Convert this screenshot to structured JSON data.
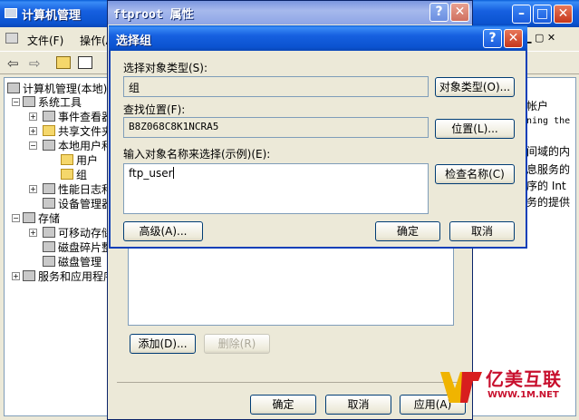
{
  "main_window": {
    "title": "计算机管理",
    "menu": [
      "文件(F)",
      "操作(A)"
    ],
    "tree": {
      "root": "计算机管理(本地)",
      "system_tools": "系统工具",
      "event_viewer": "事件查看器",
      "shared_folders": "共享文件夹",
      "local_users": "本地用户和组",
      "users": "用户",
      "groups": "组",
      "perf_logs": "性能日志和警报",
      "device_manager": "设备管理器",
      "storage": "存储",
      "removable": "可移动存储",
      "defrag": "磁盘碎片整理",
      "disk_mgmt": "磁盘管理",
      "services": "服务和应用程序"
    },
    "right_text": [
      "帐户",
      "ning the",
      "间域的内",
      "息服务的",
      "序的 Int",
      "务的提供"
    ]
  },
  "props_window": {
    "title": "ftproot 属性",
    "add_button": "添加(D)...",
    "remove_button": "删除(R)",
    "ok_button": "确定",
    "cancel_button": "取消",
    "apply_button": "应用(A)"
  },
  "select_dialog": {
    "title": "选择组",
    "object_type_label": "选择对象类型(S):",
    "object_type_value": "组",
    "object_types_button": "对象类型(O)...",
    "location_label": "查找位置(F):",
    "location_value": "B8Z068C8K1NCRA5",
    "locations_button": "位置(L)...",
    "enter_names_label": "输入对象名称来选择(示例)(E):",
    "names_value": "ftp_user",
    "check_names_button": "检查名称(C)",
    "advanced_button": "高级(A)...",
    "ok_button": "确定",
    "cancel_button": "取消"
  },
  "watermark": {
    "brand": "亿美互联",
    "url": "WWW.1M.NET"
  }
}
